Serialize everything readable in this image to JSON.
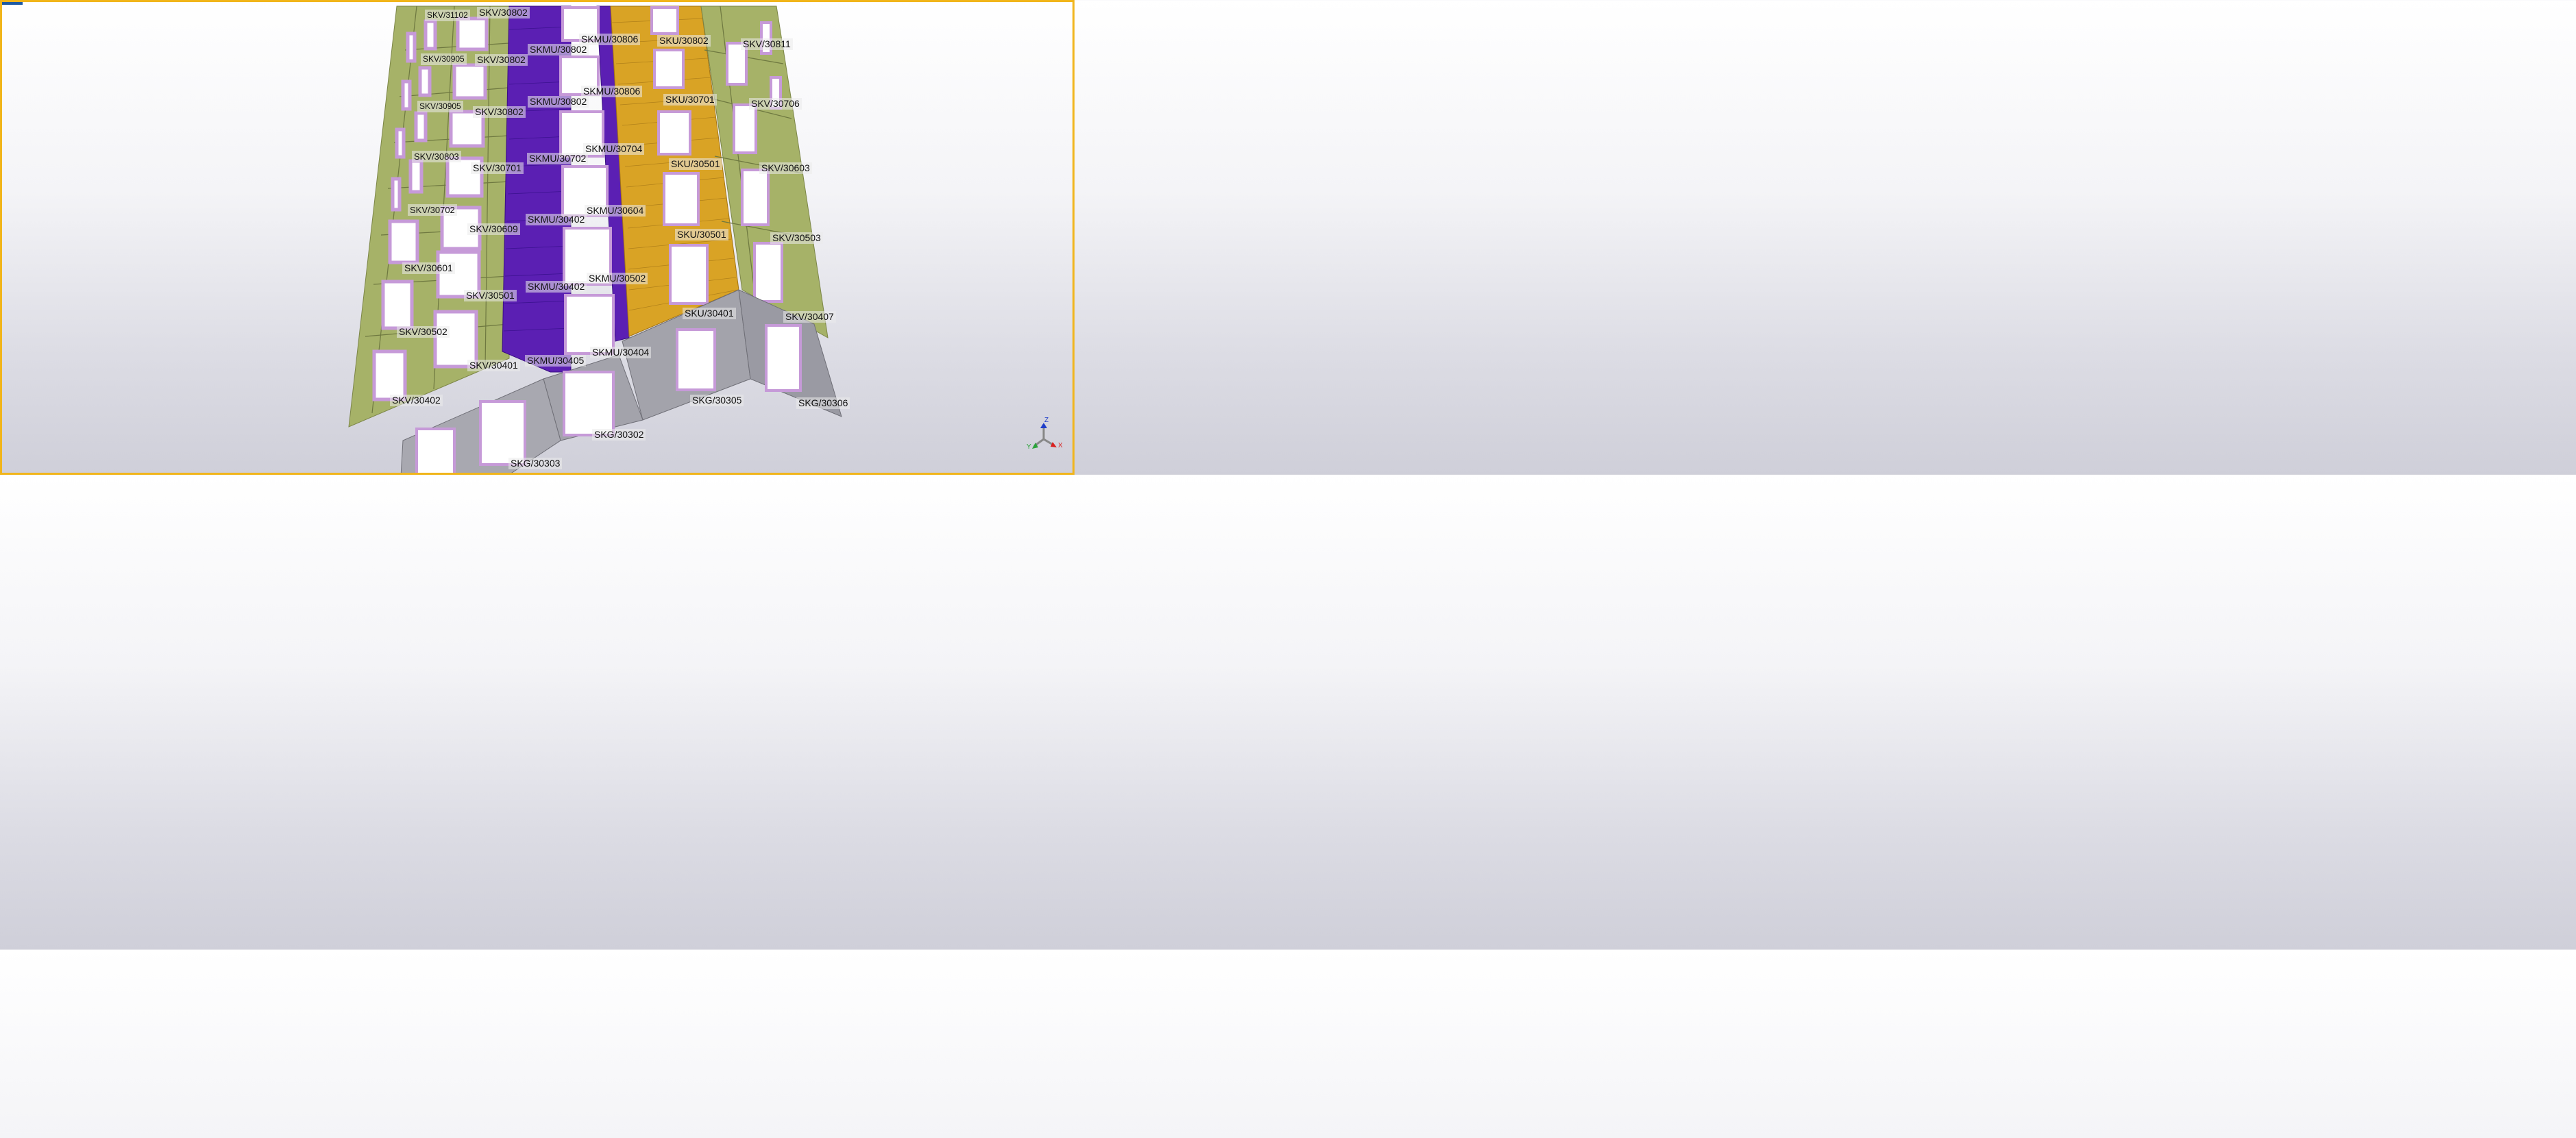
{
  "colors": {
    "frame_border": "#f1b51b",
    "panel_skv": "#a6b268",
    "panel_skmu": "#5b1fb3",
    "panel_sku": "#d9a325",
    "panel_skg": "#9c9ca4",
    "window_frame": "#c69ad8",
    "background_top": "#ffffff",
    "background_bottom": "#cfcfd9",
    "axis_x": "#d92020",
    "axis_y": "#2aa33a",
    "axis_z": "#1f3ec9"
  },
  "labels": {
    "skv_31102": "SKV/31102",
    "skv_30802_top": "SKV/30802",
    "skmu_30806_a": "SKMU/30806",
    "sku_30802": "SKU/30802",
    "skv_30811": "SKV/30811",
    "skmu_30802_a": "SKMU/30802",
    "skv_30905_a": "SKV/30905",
    "skv_30802_b": "SKV/30802",
    "skmu_30806_b": "SKMU/30806",
    "skmu_30802_b": "SKMU/30802",
    "sku_30701": "SKU/30701",
    "skv_30706": "SKV/30706",
    "skv_30905_b": "SKV/30905",
    "skv_30802_c": "SKV/30802",
    "skmu_30704": "SKMU/30704",
    "skv_30803": "SKV/30803",
    "skmu_30702": "SKMU/30702",
    "sku_30501_a": "SKU/30501",
    "skv_30701": "SKV/30701",
    "skv_30603": "SKV/30603",
    "skv_30702": "SKV/30702",
    "skmu_30604": "SKMU/30604",
    "skmu_30402_a": "SKMU/30402",
    "skv_30609": "SKV/30609",
    "sku_30501_b": "SKU/30501",
    "skv_30503": "SKV/30503",
    "skv_30601": "SKV/30601",
    "skmu_30502": "SKMU/30502",
    "skmu_30402_b": "SKMU/30402",
    "skv_30501": "SKV/30501",
    "sku_30401": "SKU/30401",
    "skv_30407": "SKV/30407",
    "skv_30502": "SKV/30502",
    "skmu_30404": "SKMU/30404",
    "skmu_30405": "SKMU/30405",
    "skv_30401": "SKV/30401",
    "skg_30305": "SKG/30305",
    "skg_30306": "SKG/30306",
    "skv_30402": "SKV/30402",
    "skg_30302": "SKG/30302",
    "skg_30303": "SKG/30303"
  },
  "triad": {
    "z": "Z",
    "x": "X",
    "y": "Y"
  }
}
